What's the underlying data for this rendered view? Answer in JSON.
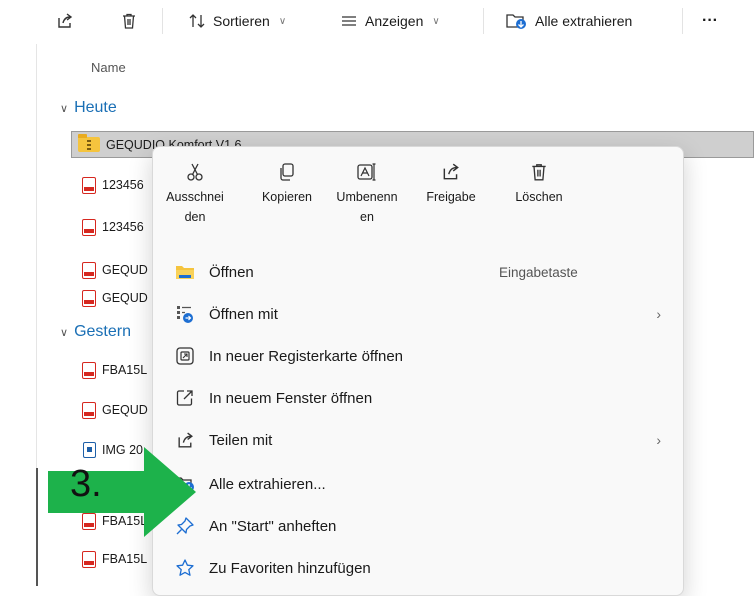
{
  "toolbar": {
    "sort_label": "Sortieren",
    "view_label": "Anzeigen",
    "extract_label": "Alle extrahieren",
    "more_label": "···",
    "icons": [
      "share-icon",
      "trash-icon",
      "sort-icon",
      "view-icon",
      "extract-icon",
      "more-icon"
    ]
  },
  "file_list": {
    "column_header": "Name",
    "groups": [
      {
        "label": "Heute"
      },
      {
        "label": "Gestern"
      }
    ],
    "rows": [
      {
        "name": "GEQUDIO Komfort V1.6",
        "type": "zip",
        "selected": true
      },
      {
        "name": "123456",
        "type": "pdf"
      },
      {
        "name": "123456",
        "type": "pdf"
      },
      {
        "name": "GEQUD",
        "type": "pdf"
      },
      {
        "name": "GEQUD",
        "type": "pdf"
      },
      {
        "name": "FBA15L",
        "type": "pdf"
      },
      {
        "name": "GEQUD",
        "type": "pdf"
      },
      {
        "name": "IMG 20",
        "type": "image"
      },
      {
        "name": "FBA15L",
        "type": "pdf"
      },
      {
        "name": "FBA15L",
        "type": "pdf"
      }
    ]
  },
  "context_menu": {
    "quick_actions": [
      {
        "label_line1": "Ausschnei",
        "label_line2": "den",
        "icon": "scissors-icon"
      },
      {
        "label_line1": "Kopieren",
        "label_line2": "",
        "icon": "copy-icon"
      },
      {
        "label_line1": "Umbenenn",
        "label_line2": "en",
        "icon": "rename-icon"
      },
      {
        "label_line1": "Freigabe",
        "label_line2": "",
        "icon": "share-icon"
      },
      {
        "label_line1": "Löschen",
        "label_line2": "",
        "icon": "trash-icon"
      }
    ],
    "items": [
      {
        "label": "Öffnen",
        "shortcut": "Eingabetaste",
        "icon": "folder-icon",
        "submenu": false
      },
      {
        "label": "Öffnen mit",
        "shortcut": "",
        "icon": "open-with-icon",
        "submenu": true
      },
      {
        "label": "In neuer Registerkarte öffnen",
        "shortcut": "",
        "icon": "new-tab-icon",
        "submenu": false
      },
      {
        "label": "In neuem Fenster öffnen",
        "shortcut": "",
        "icon": "new-window-icon",
        "submenu": false
      },
      {
        "label": "Teilen mit",
        "shortcut": "",
        "icon": "share-icon",
        "submenu": true
      },
      {
        "label": "Alle extrahieren...",
        "shortcut": "",
        "icon": "extract-icon",
        "submenu": false
      },
      {
        "label": "An \"Start\" anheften",
        "shortcut": "",
        "icon": "pin-icon",
        "submenu": false
      },
      {
        "label": "Zu Favoriten hinzufügen",
        "shortcut": "",
        "icon": "star-icon",
        "submenu": false
      }
    ],
    "submenu_arrow": "›"
  },
  "annotation": {
    "step_number": "3.",
    "arrow_color": "#1db24b"
  },
  "colors": {
    "accent": "#1a6fb5",
    "pdf": "#d6271f",
    "selection": "#cfcfcf"
  }
}
